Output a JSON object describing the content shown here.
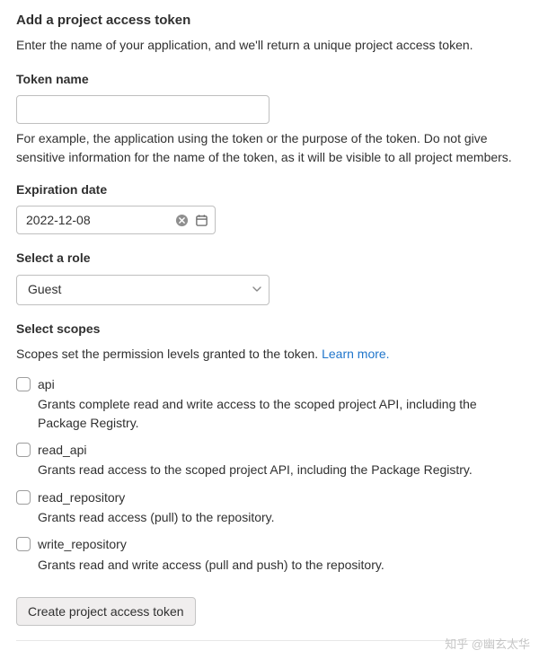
{
  "header": {
    "title": "Add a project access token",
    "intro": "Enter the name of your application, and we'll return a unique project access token."
  },
  "token_name": {
    "label": "Token name",
    "value": "",
    "help": "For example, the application using the token or the purpose of the token. Do not give sensitive information for the name of the token, as it will be visible to all project members."
  },
  "expiration": {
    "label": "Expiration date",
    "value": "2022-12-08"
  },
  "role": {
    "label": "Select a role",
    "value": "Guest"
  },
  "scopes": {
    "label": "Select scopes",
    "intro": "Scopes set the permission levels granted to the token. ",
    "learn_more": "Learn more.",
    "items": [
      {
        "name": "api",
        "desc": "Grants complete read and write access to the scoped project API, including the Package Registry.",
        "checked": false
      },
      {
        "name": "read_api",
        "desc": "Grants read access to the scoped project API, including the Package Registry.",
        "checked": false
      },
      {
        "name": "read_repository",
        "desc": "Grants read access (pull) to the repository.",
        "checked": false
      },
      {
        "name": "write_repository",
        "desc": "Grants read and write access (pull and push) to the repository.",
        "checked": false
      }
    ]
  },
  "submit_label": "Create project access token",
  "watermark": "知乎 @幽玄太华"
}
